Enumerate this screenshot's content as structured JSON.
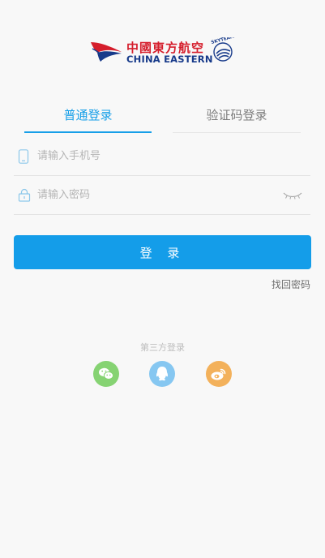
{
  "brand": {
    "name_cn": "中國東方航空",
    "name_en": "CHINA EASTERN",
    "alliance": "SKYTEAM"
  },
  "tabs": [
    {
      "label": "普通登录",
      "active": true
    },
    {
      "label": "验证码登录",
      "active": false
    }
  ],
  "form": {
    "phone_placeholder": "请输入手机号",
    "phone_value": "",
    "password_placeholder": "请输入密码",
    "password_value": ""
  },
  "login_button": "登 录",
  "forgot_password": "找回密码",
  "third_party": {
    "title": "第三方登录",
    "providers": [
      {
        "name": "WeChat",
        "icon": "wechat-icon",
        "color": "#86d373"
      },
      {
        "name": "QQ",
        "icon": "qq-icon",
        "color": "#86c7f1"
      },
      {
        "name": "Weibo",
        "icon": "weibo-icon",
        "color": "#f3b15b"
      }
    ]
  },
  "colors": {
    "accent": "#149de9",
    "brand_red": "#d51e2c",
    "brand_blue": "#173a8a",
    "background": "#f8f8f8"
  }
}
